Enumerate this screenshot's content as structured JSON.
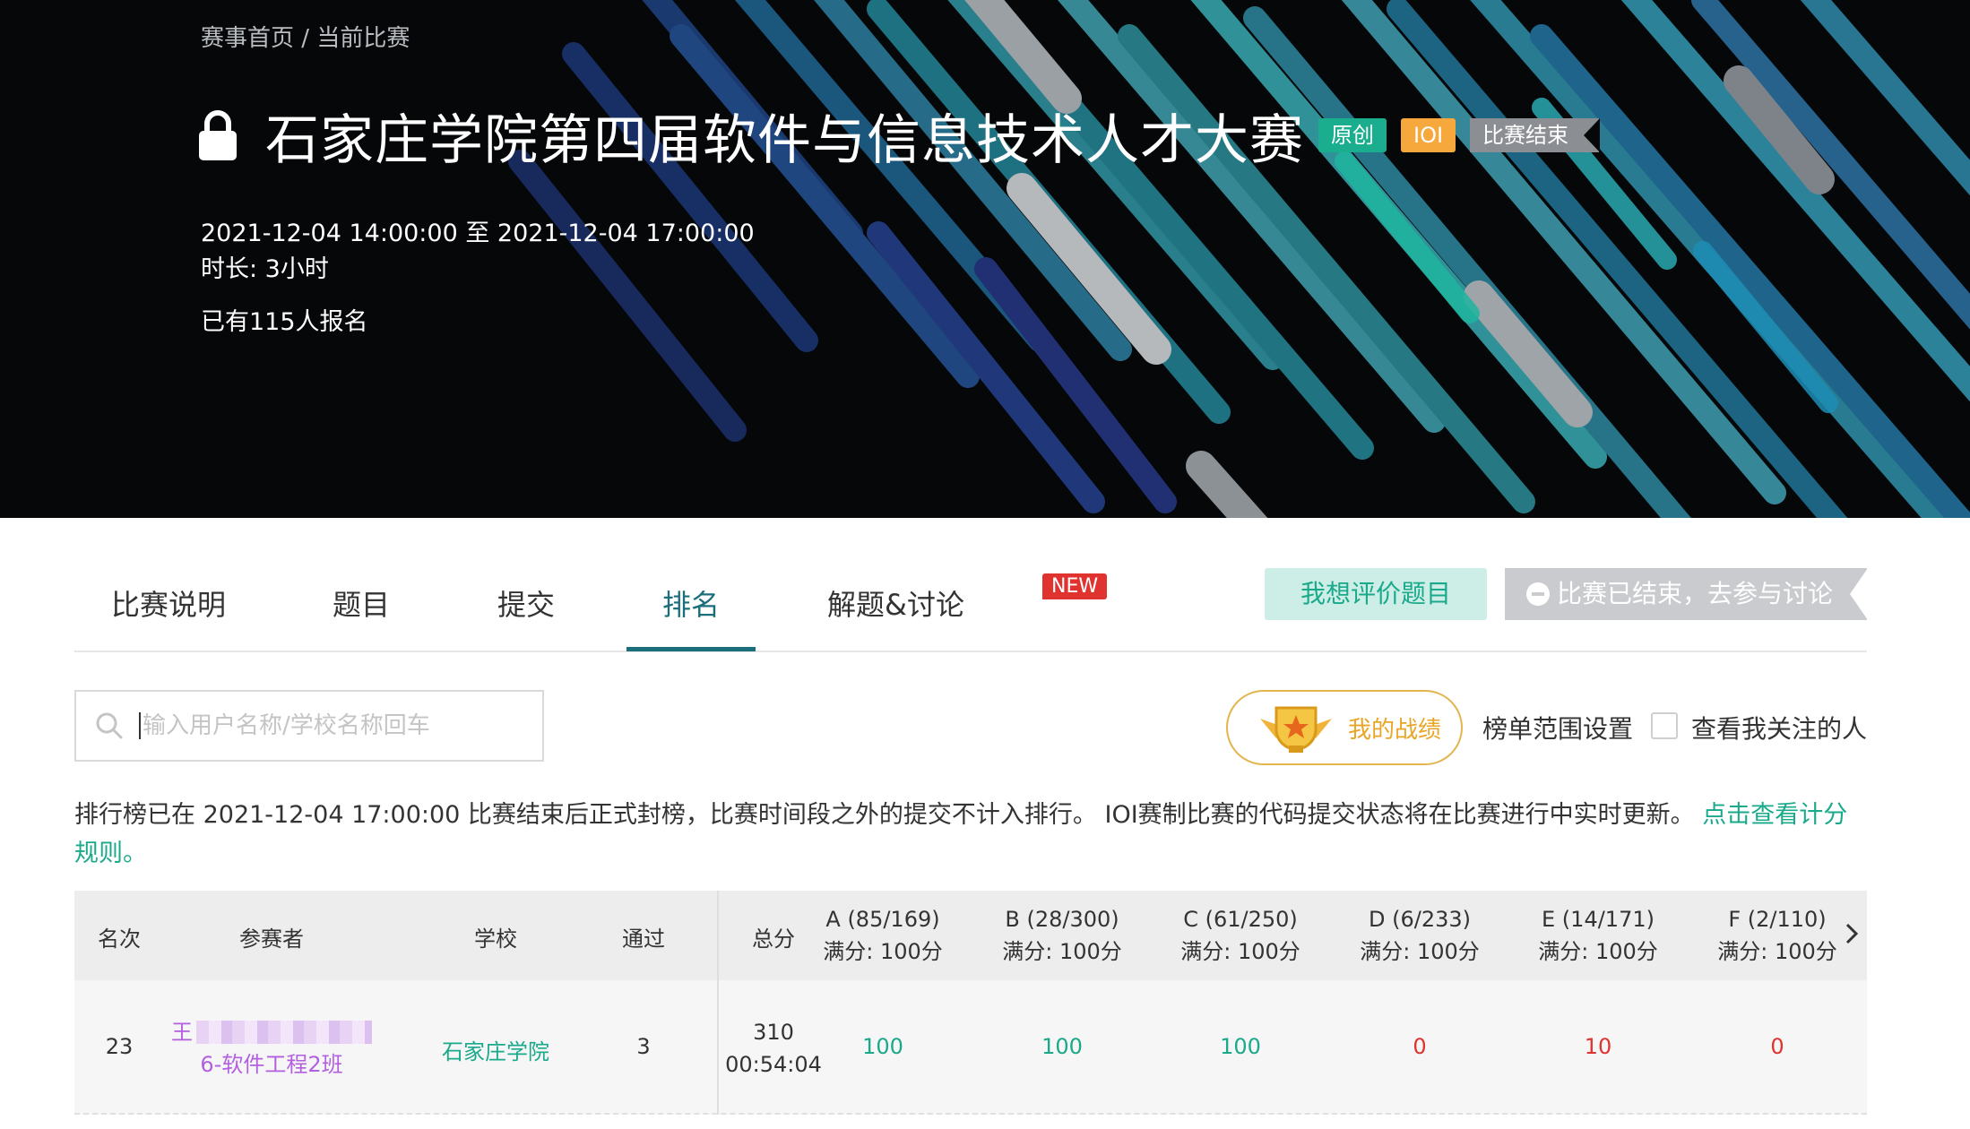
{
  "breadcrumb": {
    "home": "赛事首页",
    "sep": "/",
    "current": "当前比赛"
  },
  "contest": {
    "title": "石家庄学院第四届软件与信息技术人才大赛",
    "tags": [
      "原创",
      "IOI",
      "比赛结束"
    ],
    "time_range": "2021-12-04 14:00:00 至 2021-12-04 17:00:00",
    "duration": "时长: 3小时",
    "registered": "已有115人报名"
  },
  "tabs": [
    {
      "label": "比赛说明"
    },
    {
      "label": "题目"
    },
    {
      "label": "提交"
    },
    {
      "label": "排名",
      "active": true
    },
    {
      "label": "解题&讨论",
      "badge": "NEW"
    }
  ],
  "actions": {
    "evaluate": "我想评价题目",
    "discuss": "比赛已结束，去参与讨论"
  },
  "search": {
    "placeholder": "输入用户名称/学校名称回车"
  },
  "toolbar": {
    "my_record": "我的战绩",
    "range_setting": "榜单范围设置",
    "follow_label": "查看我关注的人"
  },
  "notice": {
    "text": "排行榜已在 2021-12-04 17:00:00 比赛结束后正式封榜，比赛时间段之外的提交不计入排行。 IOI赛制比赛的代码提交状态将在比赛进行中实时更新。",
    "link": "点击查看计分规则。"
  },
  "table": {
    "headers": {
      "rank": "名次",
      "participant": "参赛者",
      "school": "学校",
      "passed": "通过",
      "total": "总分"
    },
    "problems": [
      {
        "title": "A (85/169)",
        "full": "满分: 100分"
      },
      {
        "title": "B (28/300)",
        "full": "满分: 100分"
      },
      {
        "title": "C (61/250)",
        "full": "满分: 100分"
      },
      {
        "title": "D (6/233)",
        "full": "满分: 100分"
      },
      {
        "title": "E (14/171)",
        "full": "满分: 100分"
      },
      {
        "title": "F (2/110)",
        "full": "满分: 100分"
      }
    ],
    "rows": [
      {
        "rank": "23",
        "name": "王",
        "class": "6-软件工程2班",
        "school": "石家庄学院",
        "passed": "3",
        "score": "310",
        "time": "00:54:04",
        "scores": [
          "100",
          "100",
          "100",
          "0",
          "10",
          "0"
        ]
      }
    ]
  },
  "colors": {
    "accent": "#1b6f7a",
    "green": "#1aa98a",
    "red": "#e0322f",
    "purple": "#b25fe0",
    "gold": "#e8a526"
  }
}
